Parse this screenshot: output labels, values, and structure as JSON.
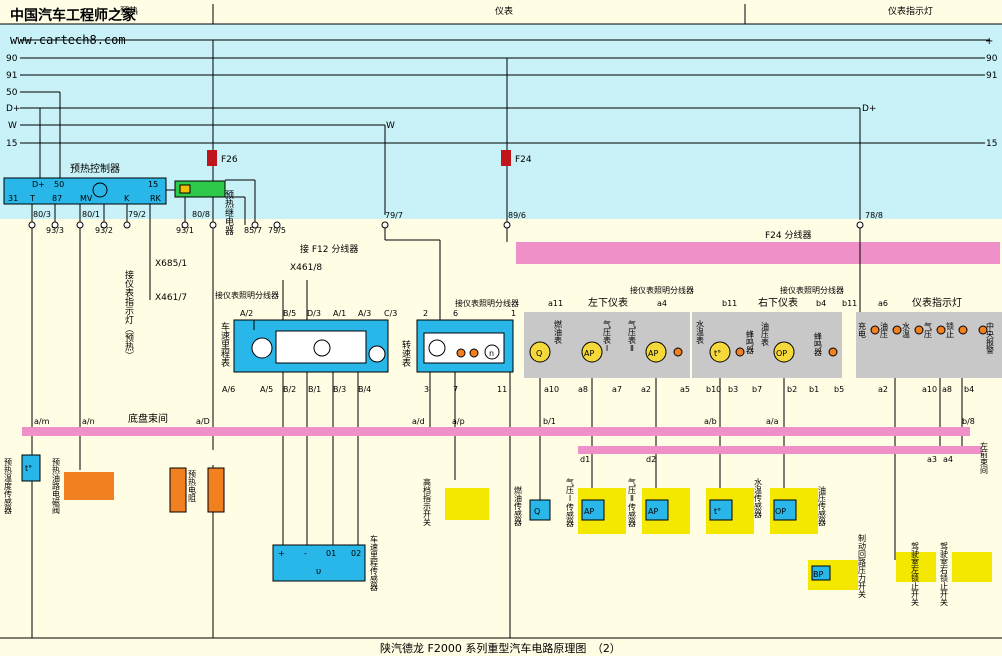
{
  "header": {
    "site_title": "中国汽车工程师之家",
    "site_url": "www.cartech8.com",
    "sections": [
      "预热",
      "仪表",
      "仪表指示灯"
    ]
  },
  "rails": {
    "plus": "+",
    "r90": "90",
    "r91": "91",
    "r50": "50",
    "d_plus": "D+",
    "d_plus_right": "D+",
    "w": "W",
    "r15": "15"
  },
  "fuses": {
    "f26": "F26",
    "f24": "F24"
  },
  "preheat": {
    "controller_title": "预热控制器",
    "pins_top": [
      "D+",
      "50",
      "15"
    ],
    "pins_bottom": [
      "31",
      "T",
      "87",
      "MV",
      "K",
      "RK"
    ],
    "relay_label": "预热继电器",
    "connectors": [
      "80/3",
      "93/3",
      "80/1",
      "93/2",
      "79/2",
      "80/8",
      "93/1",
      "85/7",
      "79/5"
    ],
    "x685": "X685/1",
    "x461_7": "X461/7",
    "note_indicator": "接仪表指示灯（预热）"
  },
  "instruments": {
    "f12_note": "接 F12 分线器",
    "x461_8": "X461/8",
    "light_note_left": "接仪表照明分线器",
    "light_note_mid": "接仪表照明分线器",
    "light_note_right": "接仪表照明分线器",
    "light_note_far": "接仪表照明分线器",
    "speedometer_label": "车速里程表",
    "speedometer_top": [
      "A/2",
      "B/5",
      "D/3",
      "A/1",
      "A/3",
      "C/3"
    ],
    "speedometer_bottom": [
      "A/6",
      "A/5",
      "B/2",
      "B/1",
      "B/3",
      "B/4"
    ],
    "tacho_label": "转速表",
    "tacho_top": [
      "2",
      "6",
      "1"
    ],
    "tacho_bottom": [
      "3",
      "7",
      "11"
    ],
    "left_cluster_title": "左下仪表",
    "right_cluster_title": "右下仪表",
    "indicator_title": "仪表指示灯",
    "f24_splitter": "F24 分线器",
    "f24_conn": "89/6",
    "conn_79_7": "79/7",
    "conn_78_8": "78/8",
    "left_gauges": [
      "燃油表",
      "气压表Ⅰ",
      "气压表Ⅱ"
    ],
    "right_gauges": [
      "水温表",
      "蜂鸣器",
      "油压表",
      "蜂鸣器"
    ],
    "left_pins_top": [
      "a11",
      "a4"
    ],
    "left_pins_bottom": [
      "a10",
      "a8",
      "a7",
      "a2",
      "a5"
    ],
    "right_pins_top": [
      "b11",
      "b4"
    ],
    "right_pins_bottom": [
      "b10",
      "b3",
      "b7",
      "b2",
      "b1",
      "b5"
    ],
    "indicator_pins_top": [
      "b11",
      "a6"
    ],
    "indicator_pins_bottom": [
      "a2",
      "a10",
      "a8",
      "b4"
    ],
    "indicator_lamps": [
      "充电",
      "油压",
      "水温",
      "气压",
      "锁止",
      "中央报警"
    ]
  },
  "harness": {
    "label": "底盘束间",
    "right_label": "左前束间",
    "pins": [
      "a/m",
      "a/n",
      "a/D",
      "a/d",
      "a/p",
      "b/1",
      "a/b",
      "a/a",
      "b/8",
      "a3",
      "a4",
      "d1",
      "d2"
    ]
  },
  "sensors": {
    "preheat_temp": "预热温度传感器",
    "preheat_valve": "预热油路电磁阀",
    "preheat_resistor": "预热电阻",
    "speed_sensor": "车速里程传感器",
    "speed_sensor_pins": [
      "+",
      "-",
      "01",
      "02"
    ],
    "speed_sensor_symbol": "υ",
    "high_gear_switch": "高档指示开关",
    "fuel_sensor": "燃油传感器",
    "air1_sensor": "气压Ⅰ传感器",
    "air2_sensor": "气压Ⅱ传感器",
    "water_sensor": "水温传感器",
    "oil_sensor": "油压传感器",
    "brake_switch": "制动回路压力开关",
    "cab_left_switch": "驾驶室左锁止开关",
    "cab_right_switch": "驾驶室右锁止开关",
    "symbols": {
      "q": "Q",
      "ap": "AP",
      "t": "t°",
      "op": "OP",
      "bp": "BP",
      "n": "n"
    }
  },
  "footer": {
    "title": "陕汽德龙 F2000 系列重型汽车电路原理图　（2）"
  }
}
